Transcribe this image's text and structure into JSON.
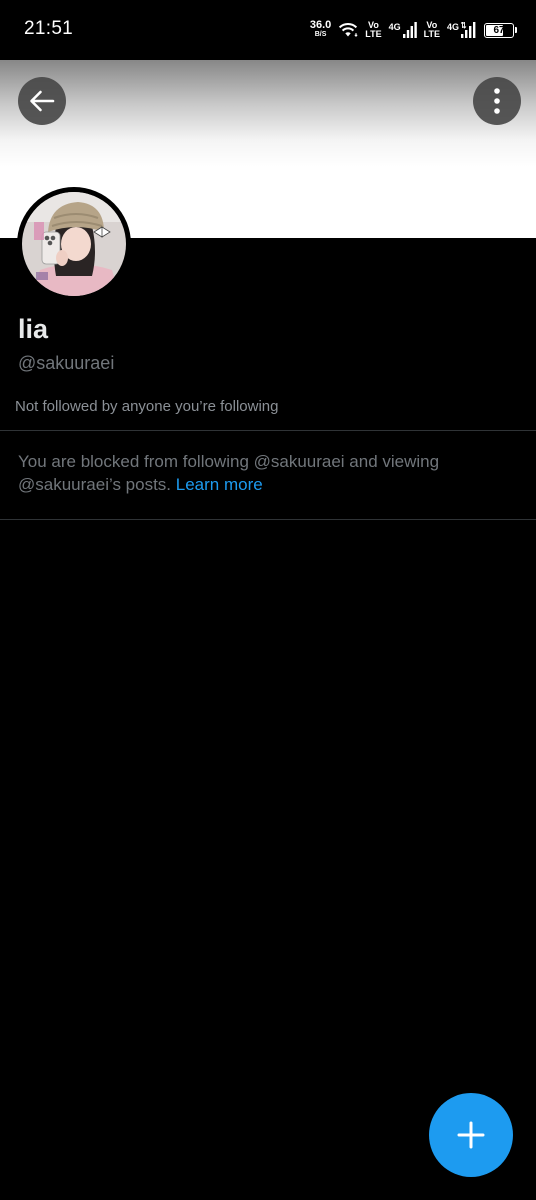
{
  "status_bar": {
    "time": "21:51",
    "net_speed_value": "36.0",
    "net_speed_unit": "B/S",
    "sim1_volte_top": "Vo",
    "sim1_volte_bottom": "LTE",
    "sim1_network": "4G",
    "sim2_volte_top": "Vo",
    "sim2_volte_bottom": "LTE",
    "sim2_network": "4G",
    "battery_level": "67",
    "battery_fraction": 0.67
  },
  "header": {
    "back_icon": "arrow-left-icon",
    "more_icon": "more-vertical-icon"
  },
  "profile": {
    "display_name": "lia",
    "handle": "@sakuuraei",
    "followed_by": "Not followed by anyone you’re following",
    "blocked_message": "You are blocked from following @sakuuraei and viewing @sakuuraei’s posts.",
    "learn_more": "Learn more"
  },
  "fab": {
    "icon": "plus-icon"
  },
  "colors": {
    "background": "#000000",
    "accent": "#1d9bf0",
    "secondary_text": "#71767b",
    "divider": "#2f3336"
  }
}
